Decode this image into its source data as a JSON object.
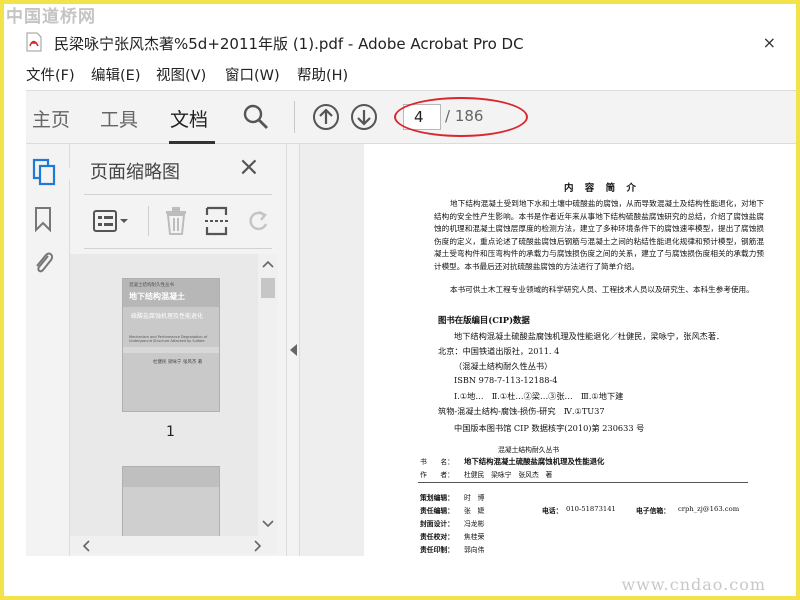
{
  "watermark": {
    "top": "中国道桥网",
    "bottom": "www.cndao.com"
  },
  "window": {
    "title": "民梁咏宁张风杰著%5d+2011年版 (1).pdf - Adobe Acrobat Pro DC",
    "close_label": "×"
  },
  "menu": [
    "文件(F)",
    "编辑(E)",
    "视图(V)",
    "窗口(W)",
    "帮助(H)"
  ],
  "tabs": [
    "主页",
    "工具",
    "文档"
  ],
  "pagination": {
    "current": "4",
    "total": "/ 186"
  },
  "panel": {
    "title": "页面缩略图",
    "close_label": "×",
    "thumb_label": "1"
  },
  "thumbnail": {
    "series": "混凝土结构耐久性丛书",
    "title": "地下结构混凝土",
    "subtitle": "硫酸盐腐蚀机理及性能退化",
    "english": "Mechanism and Performance Degradation of Underground Structure Attacked by Sulfate",
    "authors": "杜健民 梁咏宁 张风杰 著"
  },
  "pdf_page": {
    "heading": "内 容 简 介",
    "summary": "地下结构混凝土受到地下水和土壤中硫酸盐的腐蚀，从而导致混凝土及结构性能退化，对地下结构的安全性产生影响。本书是作者近年来从事地下结构硫酸盐腐蚀研究的总结，介绍了腐蚀盐腐蚀的机理和混凝土腐蚀层厚度的检测方法，建立了多种环境条件下的腐蚀速率模型，提出了腐蚀损伤度的定义，重点论述了硫酸盐腐蚀后钢筋与混凝土之间的粘结性能退化规律和预计模型，钢筋混凝土受弯构件和压弯构件的承载力与腐蚀损伤度之间的关系，建立了与腐蚀损伤度相关的承载力预计模型。本书最后还对抗硫酸盐腐蚀的方法进行了简单介绍。",
    "audience": "本书可供土木工程专业领域的科学研究人员、工程技术人员以及研究生、本科生参考使用。",
    "cip_heading": "图书在版编目(CIP)数据",
    "cip_lines": [
      "地下结构混凝土硫酸盐腐蚀机理及性能退化／杜健民，梁咏宁，张风杰著．",
      "北京：中国铁道出版社，2011. 4",
      "（混凝土结构耐久性丛书）",
      "ISBN 978-7-113-12188-4",
      "Ⅰ.①地…　Ⅱ.①杜…②梁…③张…　Ⅲ.①地下建",
      "筑物-混凝土结构-腐蚀-损伤-研究　Ⅳ.①TU37",
      "中国版本图书馆 CIP 数据核字(2010)第 230633 号"
    ],
    "series_line": "混凝土结构耐久丛书",
    "book_label": "书　　名：",
    "book_name": "地下结构混凝土硫酸盐腐蚀机理及性能退化",
    "author_label": "作　　者：",
    "author_names": "杜健民　梁咏宁　张风杰　著",
    "editor_label": "策划编辑：",
    "editor_name": "时　博",
    "resp_label": "责任编辑：",
    "resp_name": "张　婕",
    "phone_label": "电话：",
    "phone": "010-51873141",
    "email_label": "电子信箱：",
    "email": "crph_zj@163.com",
    "cover_label": "封面设计：",
    "cover_name": "冯龙彬",
    "proof_label": "责任校对：",
    "proof_name": "焦桂荣",
    "print_label": "责任印制：",
    "print_name": "郭向伟"
  }
}
